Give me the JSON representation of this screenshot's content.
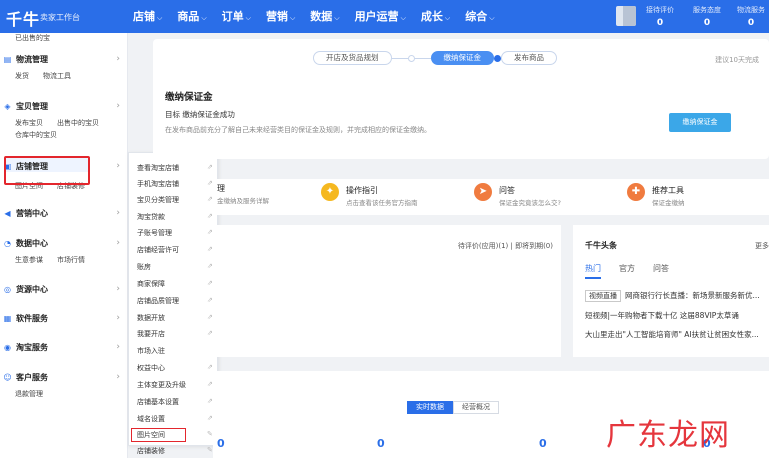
{
  "topbar": {
    "logo": "千牛",
    "subtitle": "卖家工作台",
    "nav": [
      "店铺",
      "商品",
      "订单",
      "营销",
      "数据",
      "用户运营",
      "成长",
      "综合"
    ],
    "stats": [
      {
        "label": "接待评价",
        "value": "0"
      },
      {
        "label": "服务态度",
        "value": "0"
      },
      {
        "label": "物流服务",
        "value": "0"
      }
    ]
  },
  "sidebar": {
    "partial_top": "已出售的宝",
    "groups": [
      {
        "title": "物流管理",
        "links": [
          "发货",
          "物流工具"
        ],
        "icon": "truck-icon"
      },
      {
        "title": "宝贝管理",
        "links": [
          "发布宝贝",
          "出售中的宝贝",
          "仓库中的宝贝"
        ],
        "icon": "bag-icon"
      },
      {
        "title": "店铺管理",
        "links": [
          "图片空间",
          "店铺装修"
        ],
        "icon": "store-icon"
      },
      {
        "title": "营销中心",
        "links": [],
        "icon": "megaphone-icon"
      },
      {
        "title": "数据中心",
        "links": [
          "生意参谋",
          "市场行情"
        ],
        "icon": "chart-icon"
      },
      {
        "title": "货源中心",
        "links": [],
        "icon": "source-icon"
      },
      {
        "title": "软件服务",
        "links": [],
        "icon": "grid-icon"
      },
      {
        "title": "淘宝服务",
        "links": [],
        "icon": "shield-icon"
      },
      {
        "title": "客户服务",
        "links": [
          "退款管理"
        ],
        "icon": "user-icon"
      }
    ]
  },
  "flyout": {
    "items": [
      "查看淘宝店铺",
      "手机淘宝店铺",
      "宝贝分类管理",
      "淘宝贷款",
      "子账号管理",
      "店铺经营许可",
      "账房",
      "商家保障",
      "店铺品质管理",
      "数据开放",
      "我要开店",
      "市场入驻",
      "权益中心",
      "主体变更及升级",
      "店铺基本设置",
      "域名设置",
      "图片空间",
      "店铺装修"
    ]
  },
  "steps": {
    "items": [
      "开店及货品规划",
      "缴纳保证金",
      "发布商品"
    ],
    "hint": "建议10天完成"
  },
  "deposit": {
    "title": "缴纳保证金",
    "goal": "目标 缴纳保证金成功",
    "desc": "在发布商品前充分了解自己未来经营类目的保证金及规则，并完成相应的保证金缴纳。",
    "button": "缴纳保证金"
  },
  "tools": {
    "partial_title": "理",
    "partial_desc": "金缴纳及服务详解",
    "items": [
      {
        "title": "操作指引",
        "desc": "点击查看该任务官方指南",
        "color": "#f5b820",
        "icon": "lightbulb-icon"
      },
      {
        "title": "问答",
        "desc": "保证金究竟该怎么交?",
        "color": "#f07b3f",
        "icon": "compass-icon"
      },
      {
        "title": "推荐工具",
        "desc": "保证金缴纳",
        "color": "#f07b3f",
        "icon": "wrench-icon"
      }
    ]
  },
  "mid": {
    "links": "待评价(应用)(1) | 即将到期(0)"
  },
  "news": {
    "title": "千牛头条",
    "more": "更多",
    "tabs": [
      "热门",
      "官方",
      "问答"
    ],
    "lines": [
      {
        "tag": "视频直播",
        "text": "网商银行行长直播：新场景新服务新优..."
      },
      {
        "tag": "",
        "text": "短视频|一年购物者下载十亿 这届88VIP太草诵"
      },
      {
        "tag": "",
        "text": "大山里走出\"人工智能培育师\" AI扶贫让贫困女性家..."
      }
    ]
  },
  "bottom": {
    "tabs": [
      "实时数据",
      "经营概况"
    ],
    "values": [
      "0",
      "0",
      "0",
      "0"
    ]
  },
  "watermark": "广东龙网"
}
